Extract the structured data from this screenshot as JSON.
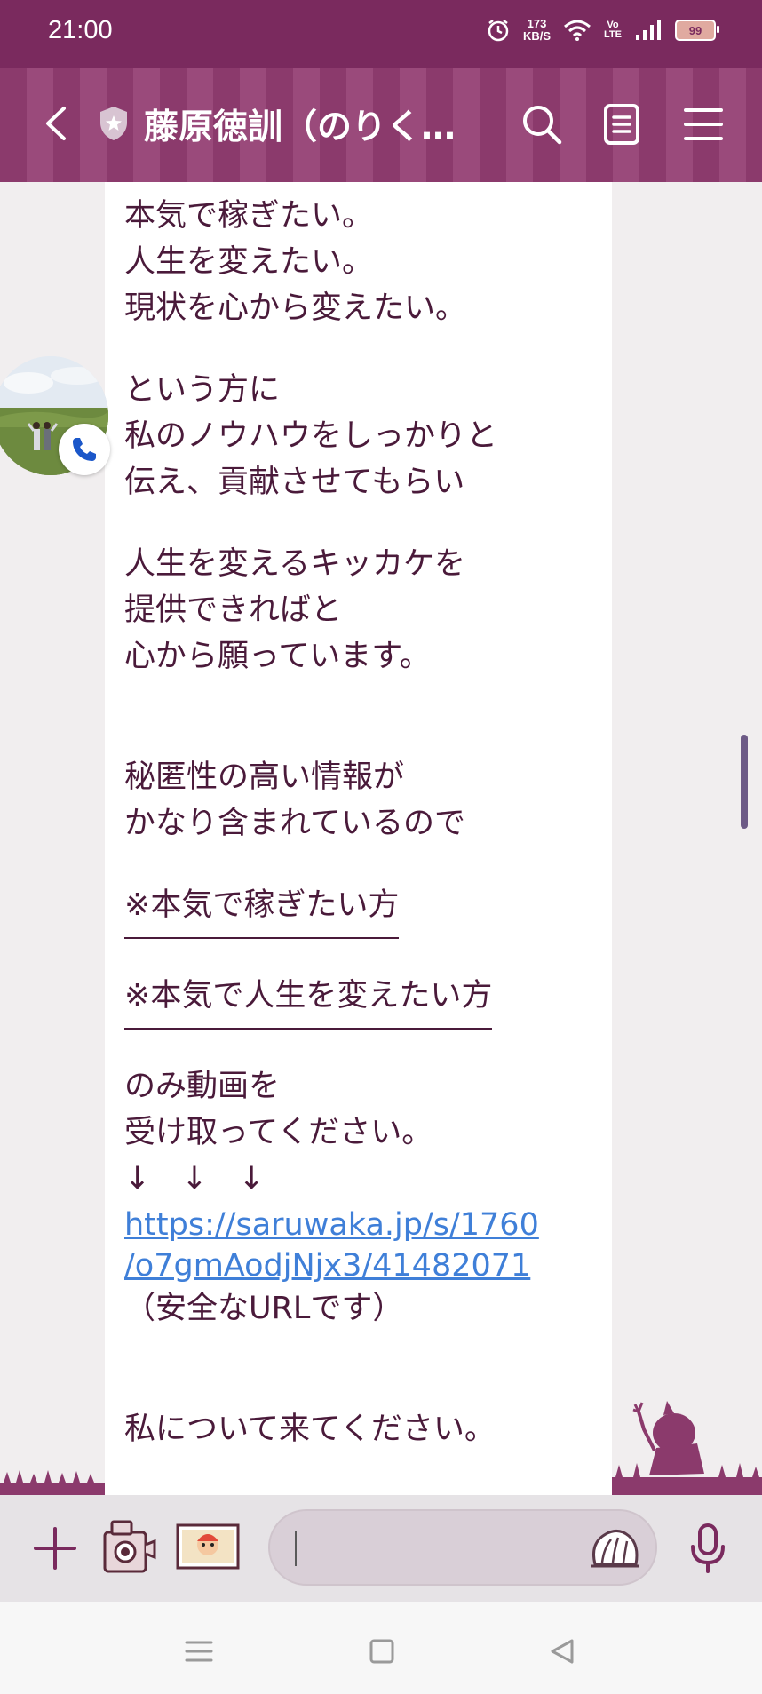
{
  "status_bar": {
    "time": "21:00",
    "network_speed_value": "173",
    "network_speed_unit": "KB/S",
    "volte_top": "Vo",
    "volte_bottom": "LTE",
    "battery": "99"
  },
  "header": {
    "title": "藤原徳訓（のりく…"
  },
  "message": {
    "lines": {
      "l1": "本気で稼ぎたい。",
      "l2": "人生を変えたい。",
      "l3": "現状を心から変えたい。",
      "l4": "という方に",
      "l5": "私のノウハウをしっかりと",
      "l6": "伝え、貢献させてもらい",
      "l7": "人生を変えるキッカケを",
      "l8": "提供できればと",
      "l9": "心から願っています。",
      "l10": "秘匿性の高い情報が",
      "l11": "かなり含まれているので",
      "l12": "※本気で稼ぎたい方",
      "l13": "※本気で人生を変えたい方",
      "l14": "のみ動画を",
      "l15": "受け取ってください。",
      "l16": "↓　↓　↓",
      "link1": "https://saruwaka.jp/s/1760",
      "link2": "/o7gmAodjNjx3/41482071",
      "l17": "（安全なURLです）",
      "l18": "私について来てください。"
    }
  },
  "colors": {
    "brand": "#7a2a5e",
    "header_stripe_a": "#8b3a6c",
    "header_stripe_b": "#9a4a7b",
    "text": "#4a1a3a",
    "link": "#3f7fd8"
  },
  "icons": {
    "back": "chevron-left-icon",
    "shield": "shield-icon",
    "search": "search-icon",
    "notes": "note-icon",
    "menu": "menu-icon",
    "call": "phone-icon",
    "plus": "plus-icon",
    "camera": "camera-icon",
    "album": "image-icon",
    "sticker": "sticker-icon",
    "mic": "microphone-icon"
  }
}
